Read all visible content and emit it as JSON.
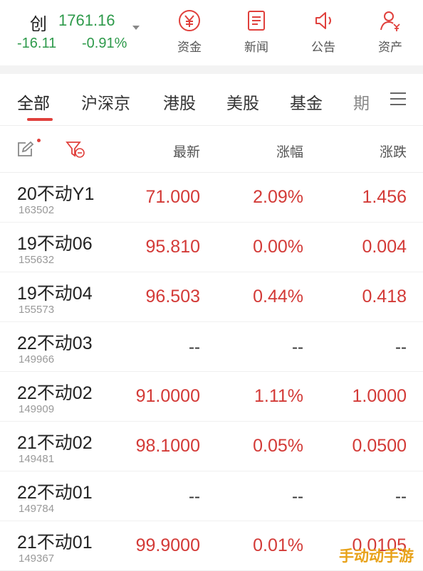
{
  "header": {
    "index_name": "创",
    "index_value": "1761.16",
    "change": "-16.11",
    "change_pct": "-0.91%",
    "colors": {
      "down": "#2e9a4b",
      "up": "#d33a37",
      "accent": "#e0403c"
    },
    "nav": [
      {
        "label": "资金",
        "icon": "yen-circle-icon"
      },
      {
        "label": "新闻",
        "icon": "news-doc-icon"
      },
      {
        "label": "公告",
        "icon": "speaker-icon"
      },
      {
        "label": "资产",
        "icon": "user-yen-icon"
      }
    ]
  },
  "tabs": [
    {
      "label": "全部",
      "active": true
    },
    {
      "label": "沪深京"
    },
    {
      "label": "港股"
    },
    {
      "label": "美股"
    },
    {
      "label": "基金"
    },
    {
      "label": "期"
    }
  ],
  "columns": {
    "last": "最新",
    "pct": "涨幅",
    "change": "涨跌"
  },
  "rows": [
    {
      "name": "20不动Y1",
      "code": "163502",
      "last": "71.000",
      "pct": "2.09%",
      "change": "1.456"
    },
    {
      "name": "19不动06",
      "code": "155632",
      "last": "95.810",
      "pct": "0.00%",
      "change": "0.004"
    },
    {
      "name": "19不动04",
      "code": "155573",
      "last": "96.503",
      "pct": "0.44%",
      "change": "0.418"
    },
    {
      "name": "22不动03",
      "code": "149966",
      "last": "--",
      "pct": "--",
      "change": "--"
    },
    {
      "name": "22不动02",
      "code": "149909",
      "last": "91.0000",
      "pct": "1.11%",
      "change": "1.0000"
    },
    {
      "name": "21不动02",
      "code": "149481",
      "last": "98.1000",
      "pct": "0.05%",
      "change": "0.0500"
    },
    {
      "name": "22不动01",
      "code": "149784",
      "last": "--",
      "pct": "--",
      "change": "--"
    },
    {
      "name": "21不动01",
      "code": "149367",
      "last": "99.9000",
      "pct": "0.01%",
      "change": "0.0105"
    }
  ],
  "watermark": "手动动手游"
}
